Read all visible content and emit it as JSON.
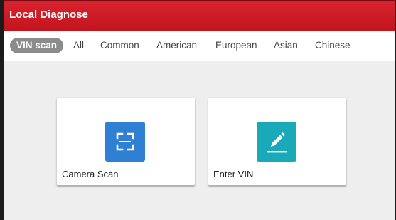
{
  "header": {
    "title": "Local Diagnose",
    "background_color": "#c8161f"
  },
  "tabs": [
    {
      "label": "VIN scan",
      "active": true
    },
    {
      "label": "All",
      "active": false
    },
    {
      "label": "Common",
      "active": false
    },
    {
      "label": "American",
      "active": false
    },
    {
      "label": "European",
      "active": false
    },
    {
      "label": "Asian",
      "active": false
    },
    {
      "label": "Chinese",
      "active": false
    }
  ],
  "cards": [
    {
      "label": "Camera Scan",
      "icon": "scan-frame-icon",
      "color": "#2f7fd3"
    },
    {
      "label": "Enter VIN",
      "icon": "pencil-edit-icon",
      "color": "#1aa9b8"
    }
  ]
}
